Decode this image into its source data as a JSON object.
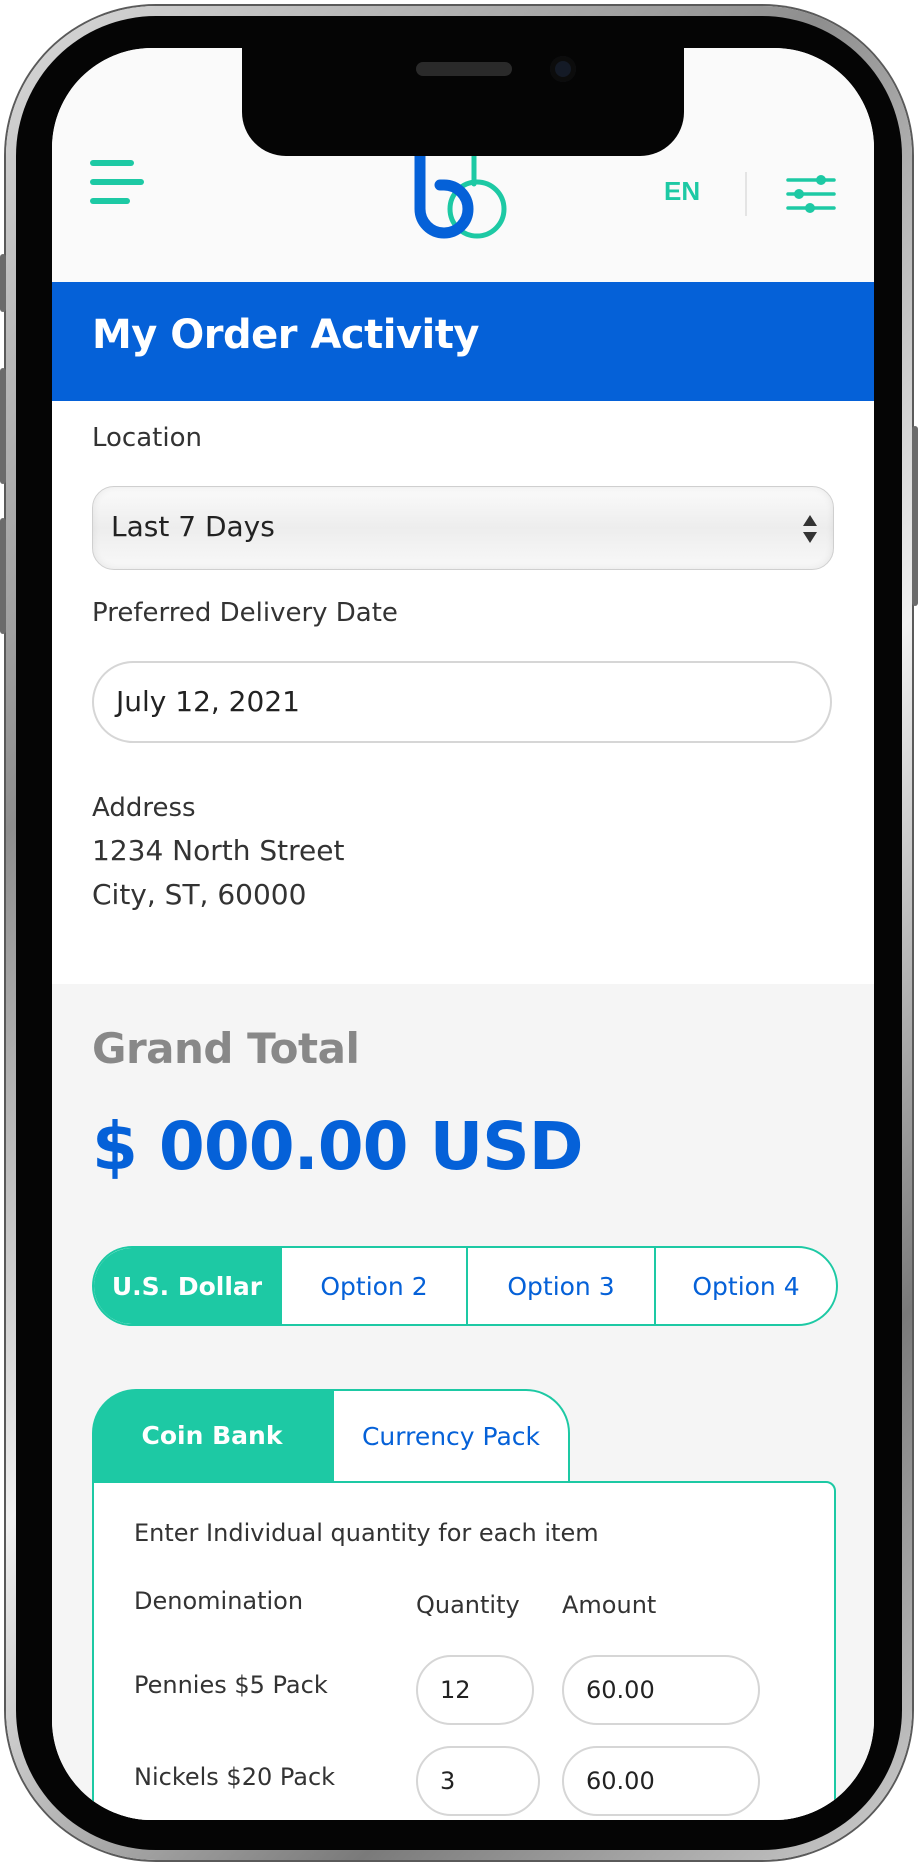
{
  "header": {
    "language": "EN"
  },
  "page": {
    "title": "My Order Activity"
  },
  "form": {
    "location_label": "Location",
    "location_value": "Last 7 Days",
    "delivery_label": "Preferred Delivery Date",
    "delivery_value": "July 12, 2021",
    "address_label": "Address",
    "address_line1": "1234 North Street",
    "address_line2": "City, ST, 60000"
  },
  "total": {
    "label": "Grand Total",
    "amount": "$ 000.00 USD"
  },
  "currency_options": [
    {
      "label": "U.S. Dollar",
      "selected": true
    },
    {
      "label": "Option 2",
      "selected": false
    },
    {
      "label": "Option 3",
      "selected": false
    },
    {
      "label": "Option 4",
      "selected": false
    }
  ],
  "tabs": [
    {
      "label": "Coin Bank",
      "active": true
    },
    {
      "label": "Currency Pack",
      "active": false
    }
  ],
  "panel": {
    "instruction": "Enter Individual quantity for each item",
    "columns": {
      "denomination": "Denomination",
      "quantity": "Quantity",
      "amount": "Amount"
    },
    "rows": [
      {
        "denomination": "Pennies $5 Pack",
        "quantity": "12",
        "amount": "60.00"
      },
      {
        "denomination": "Nickels $20 Pack",
        "quantity": "3",
        "amount": "60.00"
      }
    ]
  },
  "colors": {
    "brand_blue": "#0561d8",
    "accent_teal": "#1dc9a4"
  }
}
